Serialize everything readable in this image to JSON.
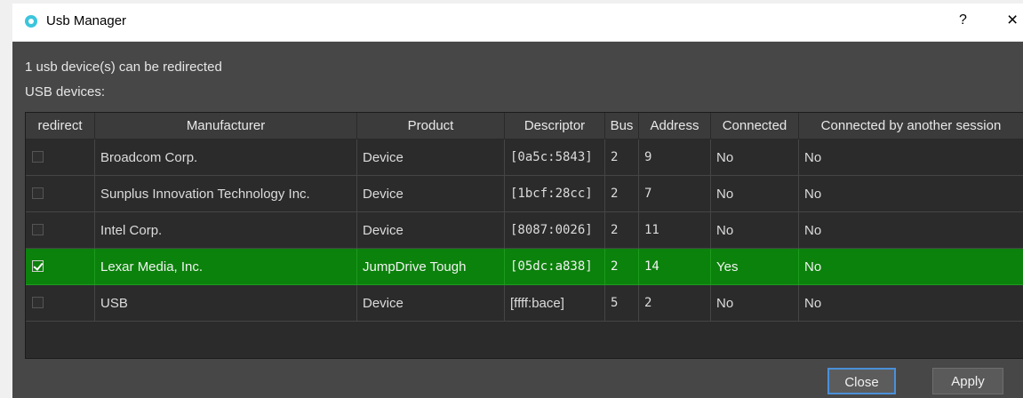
{
  "window": {
    "title": "Usb Manager",
    "help_label": "?",
    "close_label": "×"
  },
  "info": {
    "redirect_count": "1 usb device(s) can be redirected",
    "devices_label": "USB devices:"
  },
  "table": {
    "headers": {
      "redirect": "redirect",
      "manufacturer": "Manufacturer",
      "product": "Product",
      "descriptor": "Descriptor",
      "bus": "Bus",
      "address": "Address",
      "connected": "Connected",
      "connected_by_other": "Connected by another session"
    },
    "rows": [
      {
        "redirect": false,
        "manufacturer": "Broadcom Corp.",
        "product": "Device",
        "descriptor": "[0a5c:5843]",
        "bus": "2",
        "address": "9",
        "connected": "No",
        "connected_by_other": "No"
      },
      {
        "redirect": false,
        "manufacturer": "Sunplus Innovation Technology Inc.",
        "product": "Device",
        "descriptor": "[1bcf:28cc]",
        "bus": "2",
        "address": "7",
        "connected": "No",
        "connected_by_other": "No"
      },
      {
        "redirect": false,
        "manufacturer": "Intel Corp.",
        "product": "Device",
        "descriptor": "[8087:0026]",
        "bus": "2",
        "address": "11",
        "connected": "No",
        "connected_by_other": "No"
      },
      {
        "redirect": true,
        "manufacturer": "Lexar Media, Inc.",
        "product": "JumpDrive Tough",
        "descriptor": "[05dc:a838]",
        "bus": "2",
        "address": "14",
        "connected": "Yes",
        "connected_by_other": "No"
      },
      {
        "redirect": false,
        "manufacturer": "USB",
        "product": "Device",
        "descriptor": "[ffff:bace]",
        "bus": "5",
        "address": "2",
        "connected": "No",
        "connected_by_other": "No"
      }
    ]
  },
  "buttons": {
    "close": "Close",
    "apply": "Apply"
  },
  "colors": {
    "selected_row": "#0b820b",
    "dialog_bg": "#474747",
    "table_bg": "#2b2b2b"
  }
}
